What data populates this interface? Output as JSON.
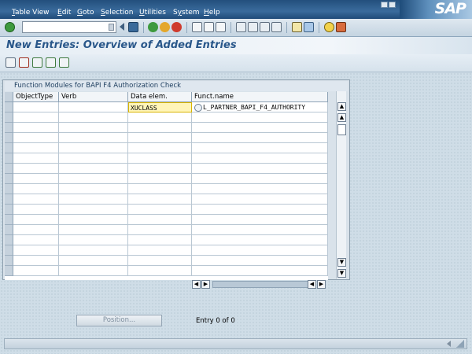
{
  "menu": {
    "items": [
      {
        "label": "Table View",
        "underline": "T",
        "rest": "able View"
      },
      {
        "label": "Edit",
        "underline": "E",
        "rest": "dit"
      },
      {
        "label": "Goto",
        "underline": "G",
        "rest": "oto"
      },
      {
        "label": "Selection",
        "underline": "S",
        "rest": "election"
      },
      {
        "label": "Utilities",
        "underline": "U",
        "rest": "tilities"
      },
      {
        "label": "System",
        "underline": "y",
        "rest": ""
      },
      {
        "label": "Help",
        "underline": "H",
        "rest": "elp"
      }
    ],
    "logo": "SAP"
  },
  "command_field": {
    "value": ""
  },
  "title": "New Entries: Overview of Added Entries",
  "table": {
    "caption": "Function Modules for BAPI F4 Authorization Check",
    "columns": [
      "ObjectType",
      "Verb",
      "Data elem.",
      "Funct.name"
    ],
    "rows": [
      {
        "object_type": "",
        "verb": "",
        "data_elem": "XUCLASS",
        "funct_name": "L_PARTNER_BAPI_F4_AUTHORITY"
      }
    ]
  },
  "footer": {
    "position_button": "Position...",
    "entry_text": "Entry 0 of 0"
  },
  "colors": {
    "menubar": "#234f7d",
    "title": "#29578a",
    "edit_cell": "#fff5b8"
  }
}
